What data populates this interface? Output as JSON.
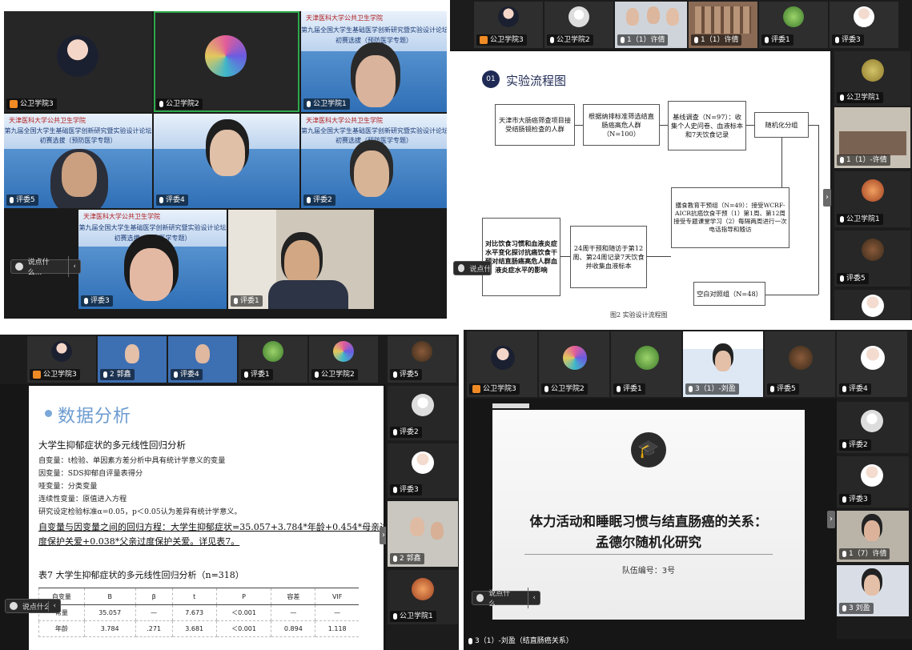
{
  "p1": {
    "tiles": [
      {
        "name": "公卫学院3"
      },
      {
        "name": "公卫学院2"
      },
      {
        "name": "公卫学院1"
      },
      {
        "name": "评委5"
      },
      {
        "name": "评委4"
      },
      {
        "name": "评委2"
      },
      {
        "name": "评委3"
      },
      {
        "name": "评委1"
      }
    ],
    "banner_logo": "天津医科大学公共卫生学院",
    "banner_title1": "第九届全国大学生基础医学创新研究暨实验设计论坛",
    "banner_title2": "初赛选拔（预防医学专题）",
    "chat_placeholder": "说点什么..."
  },
  "p2": {
    "strip": [
      {
        "name": "公卫学院3"
      },
      {
        "name": "公卫学院2"
      },
      {
        "name": "1（1）许倩"
      },
      {
        "name": "1（1）许倩"
      },
      {
        "name": "评委1"
      },
      {
        "name": "评委3"
      }
    ],
    "side": [
      {
        "name": "公卫学院1"
      },
      {
        "name": "1（1）-许倩"
      },
      {
        "name": "公卫学院1"
      },
      {
        "name": "评委5"
      }
    ],
    "slide_num": "01",
    "slide_title": "实验流程图",
    "flow": {
      "b1": "天津市大肠癌筛查项目接受结肠镜检查的人群",
      "b2": "根据纳排标准筛选结直肠癌高危人群（N=100）",
      "b3": "基线调查（N=97）：收集个人史问卷、血液标本和7天饮食记录",
      "b4": "随机化分组",
      "b5": "膳食教育干预组（N=49）：接受WCRF-AICR抗癌饮食干预（1）第1周、第12周接受专题课堂学习（2）每隔两周进行一次电话指导和随访",
      "b6": "24周干预和随访于第12周、第24周记录7天饮食并收集血液标本",
      "b7": "对比饮食习惯和血液炎症水平变化探讨抗癌饮食干预对结直肠癌高危人群血液炎症水平的影响",
      "b8": "空白对照组（N=48）"
    },
    "caption": "图2 实验设计流程图",
    "chat_placeholder": "说点什么..."
  },
  "p3": {
    "strip": [
      {
        "name": "公卫学院3"
      },
      {
        "name": "2 郭鑫"
      },
      {
        "name": "评委4"
      },
      {
        "name": "评委1"
      },
      {
        "name": "公卫学院2"
      },
      {
        "name": "评委5"
      }
    ],
    "side": [
      {
        "name": "评委2"
      },
      {
        "name": "评委3"
      },
      {
        "name": "2 郭鑫"
      },
      {
        "name": "公卫学院1"
      }
    ],
    "title": "数据分析",
    "heading": "大学生抑郁症状的多元线性回归分析",
    "lines": [
      "自变量：t检验、单因素方差分析中具有统计学意义的变量",
      "因变量：SDS抑郁自评量表得分",
      "哑变量：分类变量",
      "连续性变量：原值进入方程",
      "研究设定检验标准α=0.05，p＜0.05认为差异有统计学意义。"
    ],
    "eq1": "自变量与因变量之间的回归方程：大学生抑郁症状=35.057+3.784*年龄+0.454*母亲过",
    "eq2": "度保护关爱+0.038*父亲过度保护关爱。详见表7。",
    "table_caption": "表7 大学生抑郁症状的多元线性回归分析（n=318）",
    "table_head": [
      "自变量",
      "B",
      "β",
      "t",
      "P",
      "容差",
      "VIF"
    ],
    "table_rows": [
      [
        "常量",
        "35.057",
        "—",
        "7.673",
        "＜0.001",
        "—",
        "—"
      ],
      [
        "年龄",
        "3.784",
        ".271",
        "3.681",
        "＜0.001",
        "0.894",
        "1.118"
      ]
    ],
    "chat_placeholder": "说点什么..."
  },
  "p4": {
    "strip": [
      {
        "name": "公卫学院3"
      },
      {
        "name": "公卫学院2"
      },
      {
        "name": "评委1"
      },
      {
        "name": "3（1）-刘盈"
      },
      {
        "name": "评委5"
      },
      {
        "name": "评委4"
      }
    ],
    "side": [
      {
        "name": "评委2"
      },
      {
        "name": "评委3"
      },
      {
        "name": "1（7）许倩"
      },
      {
        "name": "3 刘盈"
      }
    ],
    "title1": "体力活动和睡眠习惯与结直肠癌的关系：",
    "title2": "孟德尔随机化研究",
    "team": "队伍编号：3号",
    "chat_placeholder": "说点什么...",
    "bottom_name": "3（1）-刘盈（结直肠癌关系）"
  },
  "colors": {
    "green_border": "#2ea84b",
    "host_orange": "#f08a24",
    "banner_blue": "#2f6fb6"
  }
}
